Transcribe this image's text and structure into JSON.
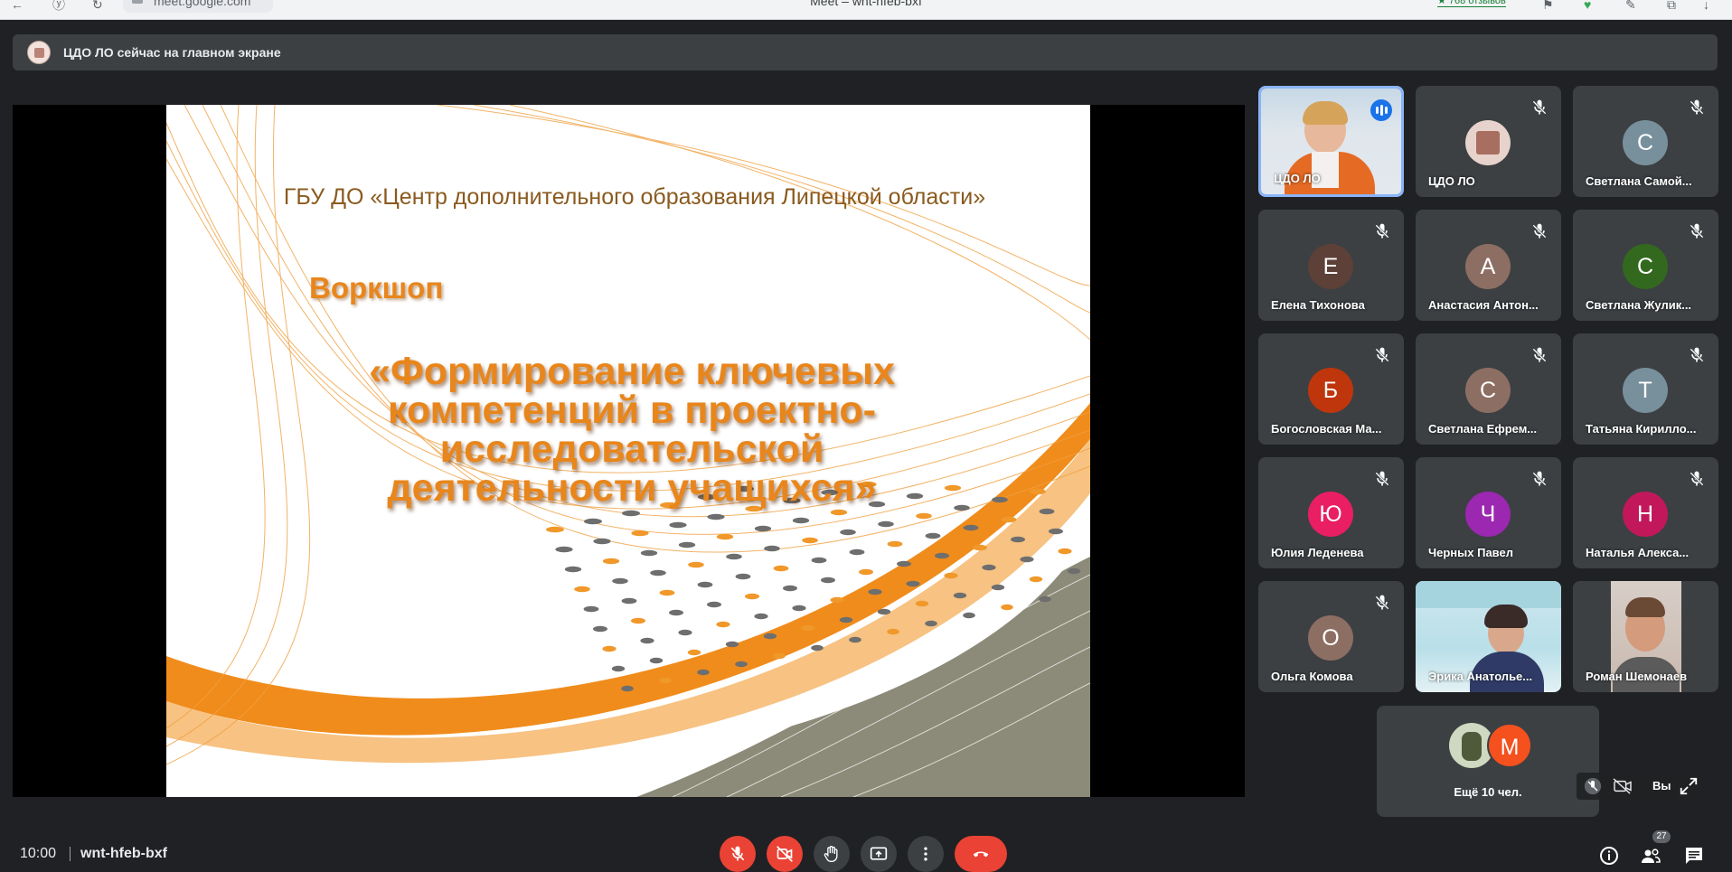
{
  "browser": {
    "url": "meet.google.com",
    "window_title": "Meet – wnt-hfeb-bxf",
    "reviews": "★ 768 отзывов"
  },
  "banner": {
    "text": "ЦДО ЛО сейчас на главном экране"
  },
  "slide": {
    "org": "ГБУ ДО «Центр дополнительного образования Липецкой области»",
    "kicker": "Воркшоп",
    "title_lines": [
      "«Формирование ключевых",
      "компетенций в проектно-",
      "исследовательской",
      "деятельности учащихся»"
    ],
    "colors": {
      "orange": "#e8861c",
      "gray": "#8a8a7a"
    }
  },
  "participants": [
    {
      "name": "ЦДО ЛО",
      "type": "video",
      "speaking": true
    },
    {
      "name": "ЦДО ЛО",
      "type": "logo"
    },
    {
      "name": "Светлана Самой...",
      "initial": "С",
      "color": "#78909c"
    },
    {
      "name": "Елена Тихонова",
      "initial": "Е",
      "color": "#5d4037"
    },
    {
      "name": "Анастасия Антон...",
      "initial": "А",
      "color": "#8d6e63"
    },
    {
      "name": "Светлана Жулик...",
      "initial": "С",
      "color": "#33691e"
    },
    {
      "name": "Богословская Ма...",
      "initial": "Б",
      "color": "#bf360c"
    },
    {
      "name": "Светлана Ефрем...",
      "initial": "С",
      "color": "#8d6e63"
    },
    {
      "name": "Татьяна Кирилло...",
      "initial": "Т",
      "color": "#78909c"
    },
    {
      "name": "Юлия Леденева",
      "initial": "Ю",
      "color": "#e91e63"
    },
    {
      "name": "Черных Павел",
      "initial": "Ч",
      "color": "#9c27b0"
    },
    {
      "name": "Наталья Алекса...",
      "initial": "Н",
      "color": "#c2185b"
    },
    {
      "name": "Ольга Комова",
      "initial": "О",
      "color": "#8d6e63"
    },
    {
      "name": "Эрика Анатолье...",
      "type": "video"
    },
    {
      "name": "Роман Шемонаев",
      "type": "video"
    }
  ],
  "more": {
    "label": "Ещё 10 чел.",
    "initial": "М",
    "color": "#f4511e"
  },
  "self": {
    "label": "Вы"
  },
  "bottom": {
    "time": "10:00",
    "meeting_code": "wnt-hfeb-bxf",
    "people_count": "27"
  },
  "icons": [
    "mic-off-icon",
    "camera-off-icon",
    "raise-hand-icon",
    "present-icon",
    "more-icon",
    "end-call-icon",
    "info-icon",
    "people-icon",
    "chat-icon",
    "expand-icon"
  ]
}
